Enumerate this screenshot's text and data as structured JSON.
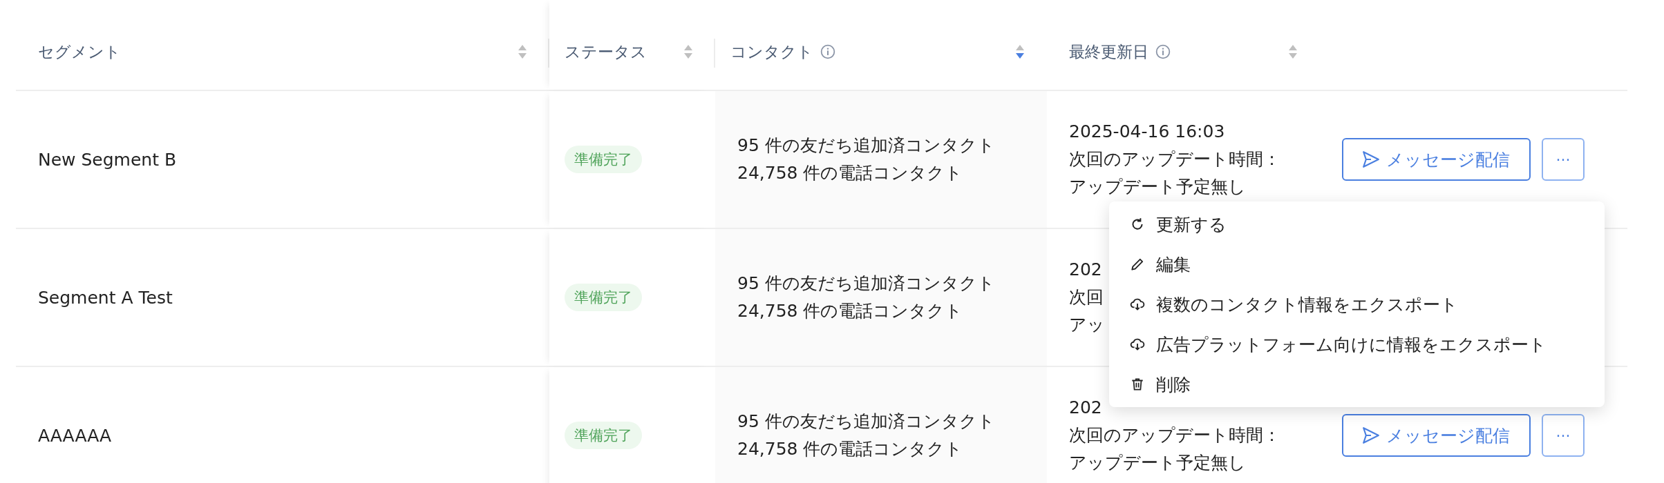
{
  "columns": [
    {
      "label": "セグメント",
      "sort_desc": false,
      "info": false
    },
    {
      "label": "ステータス",
      "sort_desc": false,
      "info": false
    },
    {
      "label": "コンタクト",
      "sort_desc": true,
      "info": true
    },
    {
      "label": "最終更新日",
      "sort_desc": false,
      "info": true
    }
  ],
  "rows": [
    {
      "segment": "New Segment B",
      "status": "準備完了",
      "contacts": [
        "95 件の友だち追加済コンタクト",
        "24,758 件の電話コンタクト"
      ],
      "updated": [
        "2025-04-16 16:03",
        "次回のアップデート時間：",
        "アップデート予定無し"
      ],
      "actions": {
        "send": "メッセージ配信",
        "more": "···"
      }
    },
    {
      "segment": "Segment A Test",
      "status": "準備完了",
      "contacts": [
        "95 件の友だち追加済コンタクト",
        "24,758 件の電話コンタクト"
      ],
      "updated": [
        "202",
        "次回",
        "アッ"
      ]
    },
    {
      "segment": "AAAAAA",
      "status": "準備完了",
      "contacts": [
        "95 件の友だち追加済コンタクト",
        "24,758 件の電話コンタクト"
      ],
      "updated": [
        "202",
        "次回のアップデート時間：",
        "アップデート予定無し"
      ],
      "actions": {
        "send": "メッセージ配信",
        "more": "···"
      }
    }
  ],
  "menu": {
    "items": [
      {
        "kind": "refresh",
        "label": "更新する"
      },
      {
        "kind": "edit",
        "label": "編集"
      },
      {
        "kind": "export",
        "label": "複数のコンタクト情報をエクスポート"
      },
      {
        "kind": "export",
        "label": "広告プラットフォーム向けに情報をエクスポート"
      },
      {
        "kind": "delete",
        "label": "削除"
      }
    ]
  }
}
